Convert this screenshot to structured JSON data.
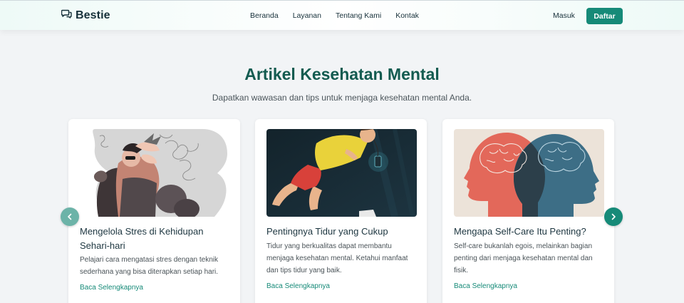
{
  "navbar": {
    "brand": "Bestie",
    "links": [
      "Beranda",
      "Layanan",
      "Tentang Kami",
      "Kontak"
    ],
    "login": "Masuk",
    "signup": "Daftar"
  },
  "header": {
    "title": "Artikel Kesehatan Mental",
    "subtitle": "Dapatkan wawasan dan tips untuk menjaga kesehatan mental Anda."
  },
  "articles": [
    {
      "title": "Mengelola Stres di Kehidupan Sehari-hari",
      "description": "Pelajari cara mengatasi stres dengan teknik sederhana yang bisa diterapkan setiap hari.",
      "link": "Baca Selengkapnya"
    },
    {
      "title": "Pentingnya Tidur yang Cukup",
      "description": "Tidur yang berkualitas dapat membantu menjaga kesehatan mental. Ketahui manfaat dan tips tidur yang baik.",
      "link": "Baca Selengkapnya"
    },
    {
      "title": "Mengapa Self-Care Itu Penting?",
      "description": "Self-care bukanlah egois, melainkan bagian penting dari menjaga kesehatan mental dan fisik.",
      "link": "Baca Selengkapnya"
    }
  ],
  "carousel": {
    "prev_icon": "chevron-left-icon",
    "next_icon": "chevron-right-icon"
  },
  "colors": {
    "primary": "#168a78",
    "title": "#135b50",
    "background": "#f2f4f6"
  }
}
